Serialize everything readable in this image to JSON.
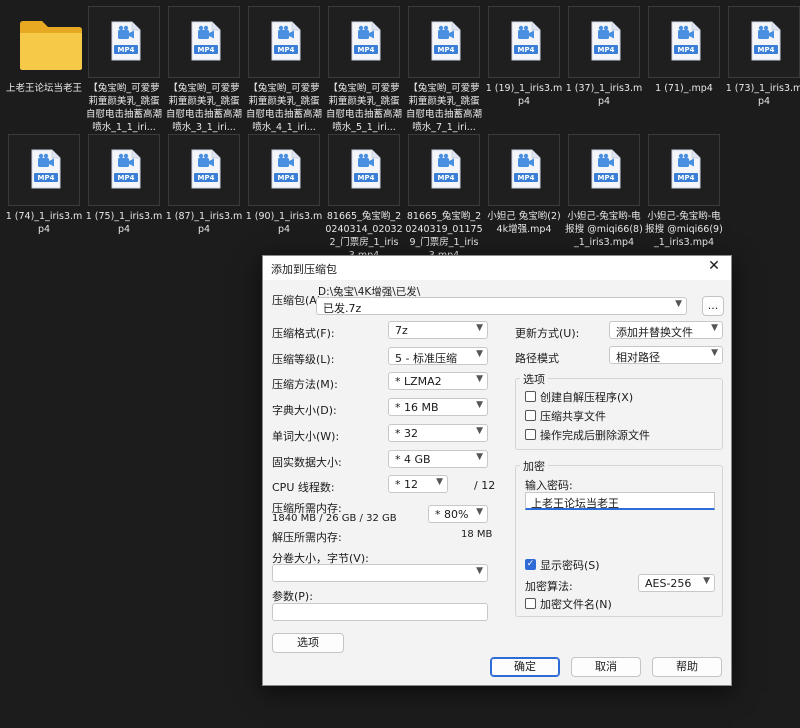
{
  "files": [
    {
      "type": "folder",
      "label": "上老王论坛当老王"
    },
    {
      "type": "mp4",
      "label": "【兔宝哟_可爱萝莉童颜美乳_跳蛋自慰电击抽蓄高潮喷水_1_1_iri..."
    },
    {
      "type": "mp4",
      "label": "【兔宝哟_可爱萝莉童颜美乳_跳蛋自慰电击抽蓄高潮喷水_3_1_iri..."
    },
    {
      "type": "mp4",
      "label": "【兔宝哟_可爱萝莉童颜美乳_跳蛋自慰电击抽蓄高潮喷水_4_1_iri..."
    },
    {
      "type": "mp4",
      "label": "【兔宝哟_可爱萝莉童颜美乳_跳蛋自慰电击抽蓄高潮喷水_5_1_iri..."
    },
    {
      "type": "mp4",
      "label": "【兔宝哟_可爱萝莉童颜美乳_跳蛋自慰电击抽蓄高潮喷水_7_1_iri..."
    },
    {
      "type": "mp4",
      "label": "1 (19)_1_iris3.mp4"
    },
    {
      "type": "mp4",
      "label": "1 (37)_1_iris3.mp4"
    },
    {
      "type": "mp4",
      "label": "1 (71)_.mp4"
    },
    {
      "type": "mp4",
      "label": "1 (73)_1_iris3.mp4"
    },
    {
      "type": "mp4",
      "label": "1 (74)_1_iris3.mp4"
    },
    {
      "type": "mp4",
      "label": "1 (75)_1_iris3.mp4"
    },
    {
      "type": "mp4",
      "label": "1 (87)_1_iris3.mp4"
    },
    {
      "type": "mp4",
      "label": "1 (90)_1_iris3.mp4"
    },
    {
      "type": "mp4",
      "label": "81665_兔宝哟_20240314_020322_门票房_1_iris3.mp4"
    },
    {
      "type": "mp4",
      "label": "81665_兔宝哟_20240319_011759_门票房_1_iris3.mp4"
    },
    {
      "type": "mp4",
      "label": "小妲己 兔宝哟(2)4k增强.mp4"
    },
    {
      "type": "mp4",
      "label": "小妲己-兔宝哟-电报搜 @miqi66(8)_1_iris3.mp4"
    },
    {
      "type": "mp4",
      "label": "小妲己-兔宝哟-电报搜 @miqi66(9)_1_iris3.mp4"
    }
  ],
  "mp4_badge": "MP4",
  "dialog": {
    "title": "添加到压缩包",
    "close": "✕",
    "archive_label": "压缩包(A)",
    "archive_dir": "D:\\兔宝\\4K增强\\已发\\",
    "archive_name": "已发.7z",
    "browse": "...",
    "left": [
      {
        "label": "压缩格式(F):",
        "value": "7z"
      },
      {
        "label": "压缩等级(L):",
        "value": "5 - 标准压缩"
      },
      {
        "label": "压缩方法(M):",
        "value": "* LZMA2"
      },
      {
        "label": "字典大小(D):",
        "value": "* 16 MB"
      },
      {
        "label": "单词大小(W):",
        "value": "* 32"
      },
      {
        "label": "固实数据大小:",
        "value": "* 4 GB"
      },
      {
        "label": "CPU 线程数:",
        "value": "* 12"
      }
    ],
    "cpu_total": "/ 12",
    "mem_compress_label": "压缩所需内存:",
    "mem_compress_detail": "1840 MB / 26 GB / 32 GB",
    "mem_compress_value": "* 80%",
    "mem_decompress_label": "解压所需内存:",
    "mem_decompress_value": "18 MB",
    "split_label": "分卷大小，字节(V):",
    "split_value": "",
    "params_label": "参数(P):",
    "params_value": "",
    "options_button": "选项",
    "update_label": "更新方式(U):",
    "update_value": "添加并替换文件",
    "path_label": "路径模式",
    "path_value": "相对路径",
    "options_group": "选项",
    "options": [
      {
        "label": "创建自解压程序(X)",
        "checked": false
      },
      {
        "label": "压缩共享文件",
        "checked": false
      },
      {
        "label": "操作完成后删除源文件",
        "checked": false
      }
    ],
    "encrypt_group": "加密",
    "password_label": "输入密码:",
    "password_value": "上老王论坛当老王",
    "show_password": "显示密码(S)",
    "encrypt_method_label": "加密算法:",
    "encrypt_method_value": "AES-256",
    "encrypt_names": "加密文件名(N)",
    "ok": "确定",
    "cancel": "取消",
    "help": "帮助"
  }
}
